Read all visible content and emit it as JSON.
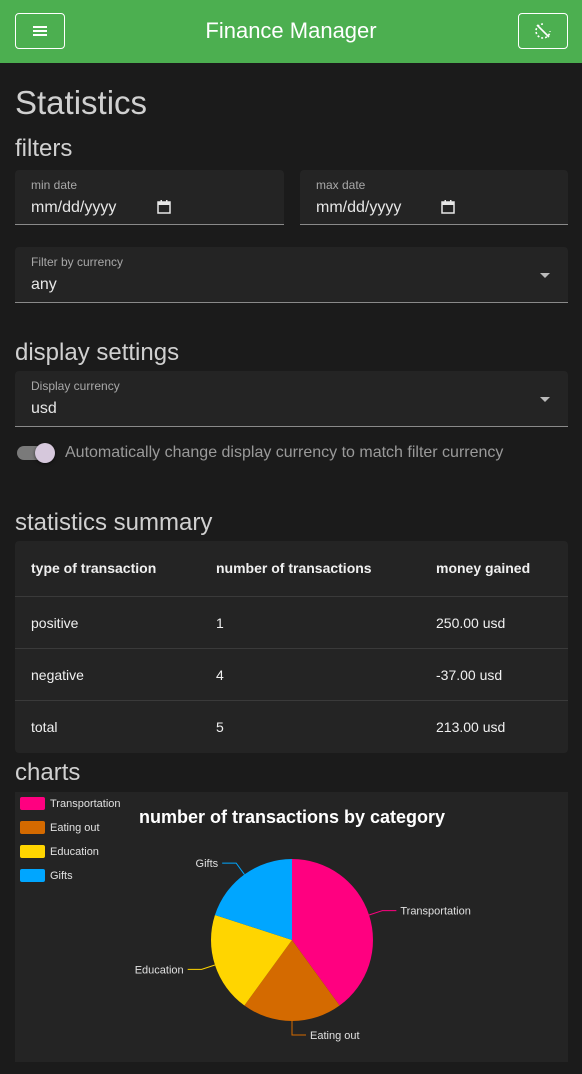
{
  "appbar": {
    "title": "Finance Manager",
    "menu_icon": "menu-icon",
    "theme_icon": "theme-toggle-icon"
  },
  "page": {
    "title": "Statistics"
  },
  "filters": {
    "heading": "filters",
    "min_date": {
      "label": "min date",
      "placeholder": "mm/dd/yyyy"
    },
    "max_date": {
      "label": "max date",
      "placeholder": "mm/dd/yyyy"
    },
    "currency": {
      "label": "Filter by currency",
      "value": "any"
    }
  },
  "display": {
    "heading": "display settings",
    "currency": {
      "label": "Display currency",
      "value": "usd"
    },
    "auto_toggle": {
      "label": "Automatically change display currency to match filter currency",
      "on": true
    }
  },
  "summary": {
    "heading": "statistics summary",
    "columns": [
      "type of transaction",
      "number of transactions",
      "money gained"
    ],
    "rows": [
      [
        "positive",
        "1",
        "250.00 usd"
      ],
      [
        "negative",
        "4",
        "-37.00 usd"
      ],
      [
        "total",
        "5",
        "213.00 usd"
      ]
    ]
  },
  "charts": {
    "heading": "charts"
  },
  "colors": {
    "appbar": "#4caf50",
    "background": "#1b1b1b",
    "panel": "#242424"
  },
  "chart_data": {
    "type": "pie",
    "title": "number of transactions by category",
    "categories": [
      "Transportation",
      "Eating out",
      "Education",
      "Gifts"
    ],
    "values": [
      2,
      1,
      1,
      1
    ],
    "colors": [
      "#ff0080",
      "#d46a00",
      "#ffd500",
      "#00a6ff"
    ],
    "legend": "top-left"
  }
}
